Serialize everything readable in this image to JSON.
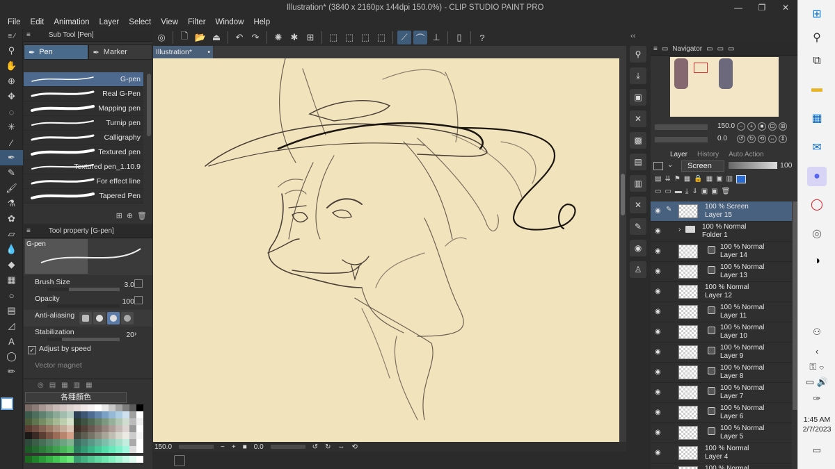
{
  "window": {
    "title": "Illustration* (3840 x 2160px 144dpi 150.0%) - CLIP STUDIO PAINT PRO",
    "minimize": "—",
    "maximize": "❐",
    "close": "✕"
  },
  "menu": [
    "File",
    "Edit",
    "Animation",
    "Layer",
    "Select",
    "View",
    "Filter",
    "Window",
    "Help"
  ],
  "subtool": {
    "title": "Sub Tool [Pen]",
    "tabs": [
      "Pen",
      "Marker"
    ],
    "pens": [
      "G-pen",
      "Real G-Pen",
      "Mapping pen",
      "Turnip pen",
      "Calligraphy",
      "Textured pen",
      "Textured pen_1.10.9",
      "For effect line",
      "Tapered Pen"
    ],
    "selected": "G-pen"
  },
  "toolprop": {
    "title": "Tool property [G-pen]",
    "preview_label": "G-pen",
    "brush_size_label": "Brush Size",
    "brush_size": "3.0",
    "opacity_label": "Opacity",
    "opacity": "100",
    "antialias_label": "Anti-aliasing",
    "stabilization_label": "Stabilization",
    "stabilization": "20",
    "adjust_label": "Adjust by speed",
    "vector_label": "Vector magnet"
  },
  "colorset": {
    "selected_set": "各種顏色",
    "colors": [
      "#7a6a66",
      "#8c7c78",
      "#a79691",
      "#b9a9a4",
      "#c8bab5",
      "#d3c6c2",
      "#ddd3cf",
      "#e6ddda",
      "#efe8e6",
      "#f5f2f1",
      "#ffffff",
      "#e8e8e8",
      "#c7c7c7",
      "#a3a3a3",
      "#7d7d7d",
      "#5a5a5a",
      "#000000",
      "#3c5a4b",
      "#4e6e5d",
      "#5f8270",
      "#739583",
      "#8aa997",
      "#a0bdad",
      "#b7d0c3",
      "#2d4054",
      "#3d5674",
      "#4e6c92",
      "#6385ac",
      "#7aa0c4",
      "#94b8d6",
      "#afcde2",
      "#cfe1ee",
      "#a0a0a0",
      "#ffffff",
      "#4a5c3a",
      "#5f7550",
      "#768c65",
      "#8da37c",
      "#a6b995",
      "#bdceaf",
      "#d5e2c9",
      "#2d3e2f",
      "#3e5341",
      "#506955",
      "#668069",
      "#7d9880",
      "#97b09a",
      "#b2c7b4",
      "#cfdccf",
      "#bbbbbb",
      "#eeeeee",
      "#5a3c32",
      "#6e4e42",
      "#836354",
      "#9a7967",
      "#b09280",
      "#c5ab99",
      "#dac5b6",
      "#3d2f28",
      "#52423a",
      "#685650",
      "#7e6c66",
      "#96857f",
      "#ae9f9a",
      "#c6bab6",
      "#ddd5d2",
      "#999999",
      "#ffffff",
      "#1c1818",
      "#3a2a26",
      "#5a3e33",
      "#7a5445",
      "#9a6b57",
      "#b9846d",
      "#d4a089",
      "#47463c",
      "#5e5d51",
      "#767467",
      "#8e8c7f",
      "#a7a598",
      "#c0beb2",
      "#d8d7cd",
      "#ebeae3",
      "#cccccc",
      "#f5f5f5",
      "#2e4a3a",
      "#3a5e48",
      "#476f58",
      "#558169",
      "#5f9173",
      "#6ea381",
      "#83b491",
      "#3b6e60",
      "#4a8273",
      "#599786",
      "#6bab98",
      "#7dbfaa",
      "#92d1bc",
      "#a8e0cc",
      "#c4ede0",
      "#aaaaaa",
      "#ffffff",
      "#1e5a28",
      "#256a30",
      "#2d7a3a",
      "#358c44",
      "#3fa04f",
      "#4ab45b",
      "#58c76a",
      "#2a7f5f",
      "#339a73",
      "#3cb386",
      "#47c999",
      "#55dcab",
      "#68e8bb",
      "#80f0cb",
      "#a0f7dd",
      "#dddddd",
      "#ffffff"
    ],
    "bottom_colors": [
      "#1a6a20",
      "#21822c",
      "#2b9a38",
      "#37b146",
      "#45c755",
      "#56d966",
      "#6ce87b",
      "#3a9a70",
      "#45b080",
      "#52c590",
      "#60d8a0",
      "#70e6af",
      "#85f0bf",
      "#a0f5d0",
      "#c0fae3",
      "#e0fcf0",
      "#ffffff"
    ]
  },
  "canvas": {
    "doc_tab": "Illustration*",
    "tab_marker": "•",
    "paper_color": "#f1e3bc",
    "zoom": "150.0",
    "rotation": "0.0"
  },
  "navigator": {
    "title": "Navigator",
    "zoom": "150.0",
    "rotation": "0.0"
  },
  "layers": {
    "tabs": [
      "Layer",
      "History",
      "Auto Action"
    ],
    "blend_mode": "Screen",
    "opacity": "100",
    "items": [
      {
        "blend": "100 % Screen",
        "name": "Layer 15",
        "type": "layer",
        "indent": 0,
        "selected": true
      },
      {
        "blend": "100 % Normal",
        "name": "Folder 1",
        "type": "folder",
        "indent": 0,
        "selected": false
      },
      {
        "blend": "100 % Normal",
        "name": "Layer 14",
        "type": "layer",
        "indent": 1,
        "selected": false
      },
      {
        "blend": "100 % Normal",
        "name": "Layer 13",
        "type": "layer",
        "indent": 1,
        "selected": false
      },
      {
        "blend": "100 % Normal",
        "name": "Layer 12",
        "type": "layer",
        "indent": 0,
        "selected": false
      },
      {
        "blend": "100 % Normal",
        "name": "Layer 11",
        "type": "layer",
        "indent": 1,
        "selected": false
      },
      {
        "blend": "100 % Normal",
        "name": "Layer 10",
        "type": "layer",
        "indent": 1,
        "selected": false
      },
      {
        "blend": "100 % Normal",
        "name": "Layer 9",
        "type": "layer",
        "indent": 1,
        "selected": false
      },
      {
        "blend": "100 % Normal",
        "name": "Layer 8",
        "type": "layer",
        "indent": 1,
        "selected": false
      },
      {
        "blend": "100 % Normal",
        "name": "Layer 7",
        "type": "layer",
        "indent": 1,
        "selected": false
      },
      {
        "blend": "100 % Normal",
        "name": "Layer 6",
        "type": "layer",
        "indent": 1,
        "selected": false
      },
      {
        "blend": "100 % Normal",
        "name": "Layer 5",
        "type": "layer",
        "indent": 1,
        "selected": false
      },
      {
        "blend": "100 % Normal",
        "name": "Layer 4",
        "type": "layer",
        "indent": 0,
        "selected": false
      },
      {
        "blend": "100 % Normal",
        "name": "",
        "type": "layer",
        "indent": 0,
        "selected": false
      }
    ]
  },
  "taskbar": {
    "time": "1:45 AM",
    "date": "2/7/2023",
    "accent": "#1c73d8"
  }
}
